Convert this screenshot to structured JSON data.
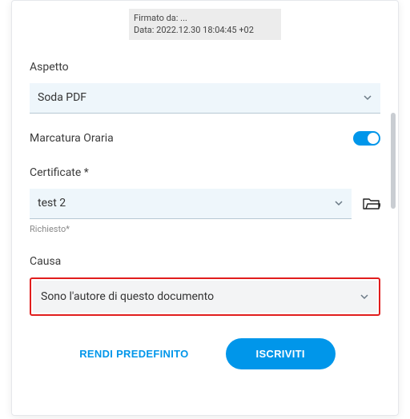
{
  "signature_preview": {
    "line1": "Firmato da: ...",
    "line2": "Data: 2022.12.30 18:04:45 +02"
  },
  "fields": {
    "appearance": {
      "label": "Aspetto",
      "value": "Soda PDF"
    },
    "timestamp": {
      "label": "Marcatura Oraria",
      "enabled": true
    },
    "certificate": {
      "label": "Certificate *",
      "value": "test 2",
      "helper": "Richiesto*"
    },
    "reason": {
      "label": "Causa",
      "value": "Sono l'autore di questo documento"
    }
  },
  "buttons": {
    "make_default": "RENDI PREDEFINITO",
    "submit": "ISCRIVITI"
  }
}
